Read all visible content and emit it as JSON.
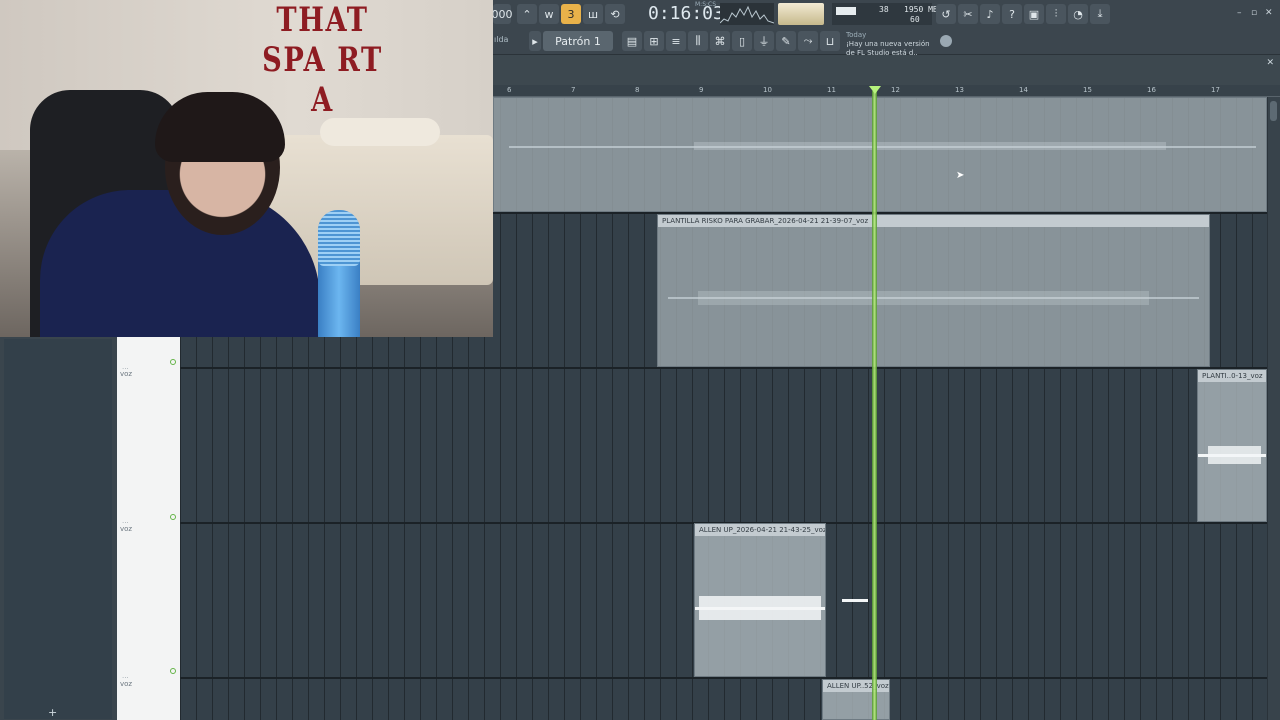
{
  "webcam": {
    "banner_text": "THAT SPA RT A"
  },
  "toolbar": {
    "time": "0:16:03",
    "time_unit": "M:S:CS",
    "cpu_value": "38",
    "memory": "1950 MB",
    "polyphony": "60",
    "pattern": "Patrón 1",
    "hint_title": "ılda",
    "news_date": "Today",
    "news_text": "¡Hay una nueva versión de FL Studio está d..",
    "counter": "000",
    "icons": [
      "metronome-icon",
      "wait-icon",
      "countdown-icon",
      "step-icon",
      "loop-record-icon"
    ]
  },
  "ruler": {
    "ticks": [
      "6",
      "7",
      "8",
      "9",
      "10",
      "11",
      "12",
      "13",
      "14",
      "15",
      "16",
      "17"
    ]
  },
  "tracks": [
    {
      "dots": "...",
      "name": "voz"
    },
    {
      "dots": "...",
      "name": "voz"
    },
    {
      "dots": "...",
      "name": "voz"
    }
  ],
  "clips": {
    "plantilla": "PLANTILLA RISKO PARA GRABAR_2026-04-21 21-39-07_voz",
    "planti_right": "PLANTI..0-13_voz",
    "allen_up": "ALLEN UP_2026-04-21 21-43-25_voz",
    "allen_up_short": "ALLEN UP..52_voz"
  }
}
